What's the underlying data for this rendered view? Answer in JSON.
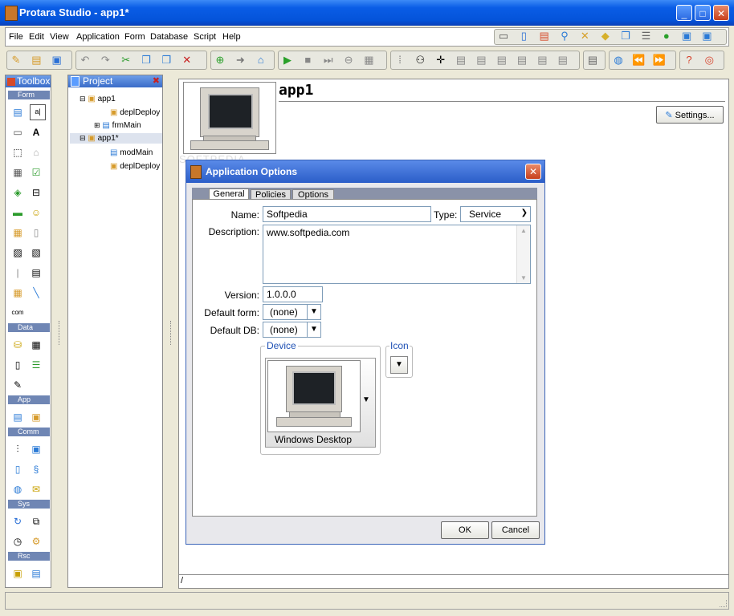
{
  "window": {
    "title": "Protara Studio - app1*"
  },
  "menu": [
    "File",
    "Edit",
    "View",
    "Application",
    "Form",
    "Database",
    "Script",
    "Help"
  ],
  "toolbox": {
    "title": "Toolbox",
    "categories": [
      "Form",
      "Data",
      "App",
      "Comm",
      "Sys",
      "Rsc"
    ],
    "selected_label": "a|"
  },
  "project": {
    "title": "Project",
    "tree": [
      "app1",
      "deplDeploy",
      "frmMain",
      "app1*",
      "modMain",
      "deplDeploy"
    ]
  },
  "main": {
    "app_name": "app1",
    "settings_label": "Settings...",
    "watermark": "SOFTPEDIA"
  },
  "dialog": {
    "title": "Application Options",
    "tabs": [
      "General",
      "Policies",
      "Options"
    ],
    "name_label": "Name:",
    "name_value": "Softpedia",
    "type_label": "Type:",
    "type_value": "Service",
    "description_label": "Description:",
    "description_value": "www.softpedia.com",
    "version_label": "Version:",
    "version_value": "1.0.0.0",
    "default_form_label": "Default form:",
    "default_form_value": "(none)",
    "default_db_label": "Default DB:",
    "default_db_value": "(none)",
    "device_legend": "Device",
    "icon_legend": "Icon",
    "device_name": "Windows Desktop",
    "ok_label": "OK",
    "cancel_label": "Cancel"
  },
  "status": {
    "path": "/"
  }
}
